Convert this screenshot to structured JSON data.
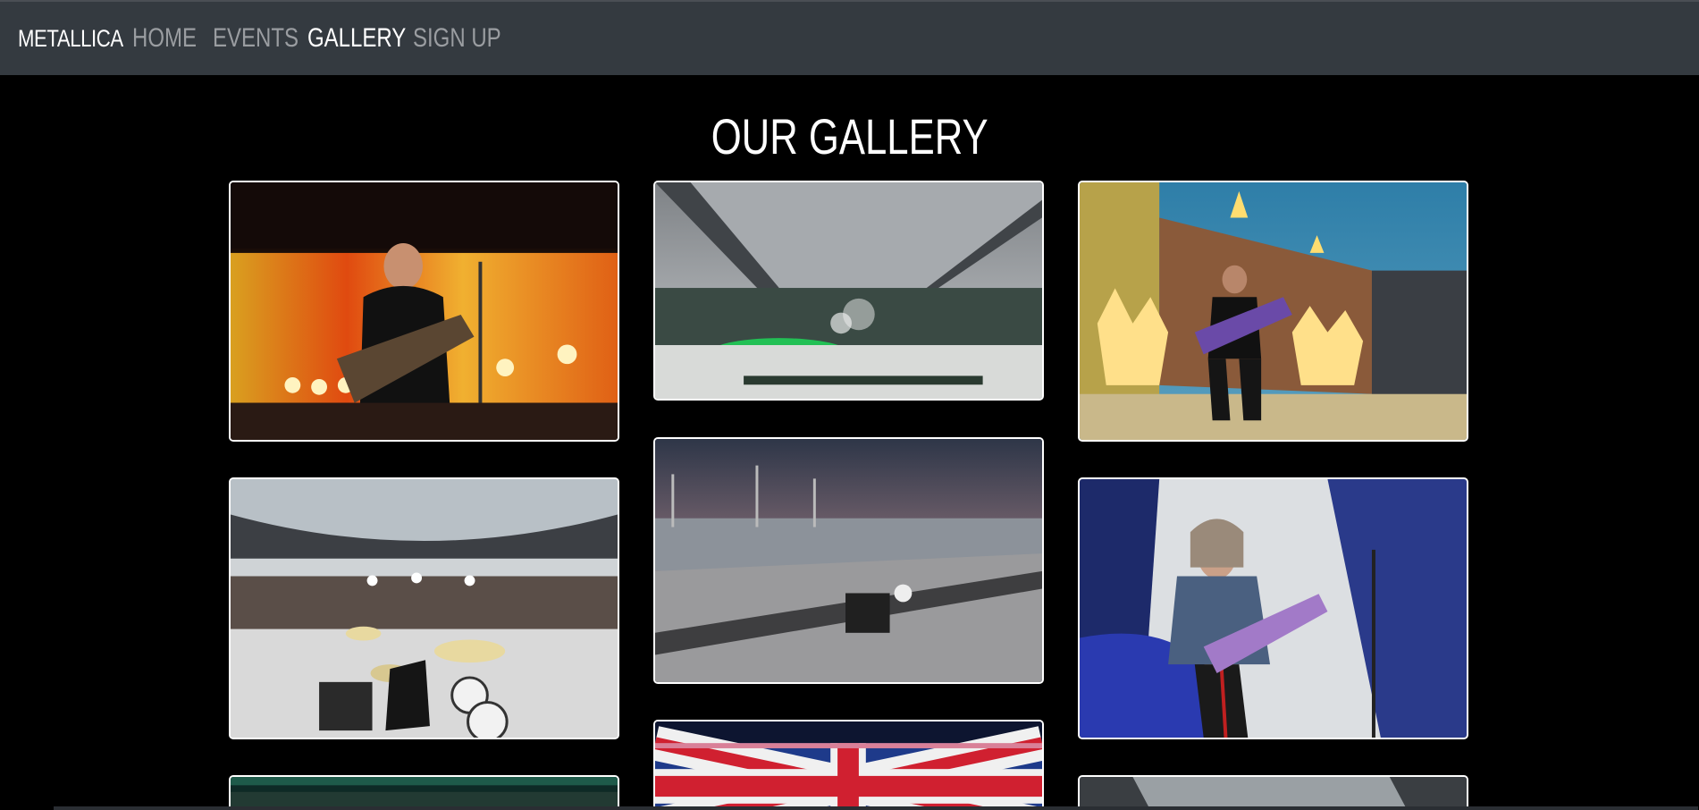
{
  "navbar": {
    "brand": "METALLICA",
    "links": [
      {
        "label": "HOME",
        "active": false
      },
      {
        "label": "EVENTS",
        "active": false
      },
      {
        "label": "GALLERY",
        "active": true
      },
      {
        "label": "SIGN UP",
        "active": false
      }
    ]
  },
  "main": {
    "heading": "OUR GALLERY"
  },
  "gallery": {
    "photos": [
      {
        "subject": "singer-guitarist-with-flames"
      },
      {
        "subject": "stadium-wide-shot"
      },
      {
        "subject": "guitarist-pyrotechnics"
      },
      {
        "subject": "drummer-stadium-view"
      },
      {
        "subject": "stage-aerial-dusk"
      },
      {
        "subject": "lead-guitarist-closeup"
      },
      {
        "subject": "union-jack-screen"
      },
      {
        "subject": "crowd-stadium-partial"
      },
      {
        "subject": "stadium-roof-partial"
      }
    ]
  },
  "colors": {
    "navbar_bg": "#343a40",
    "page_bg": "#000000",
    "nav_inactive": "#9a9da1",
    "nav_active": "#ffffff",
    "card_border": "#ffffff"
  }
}
